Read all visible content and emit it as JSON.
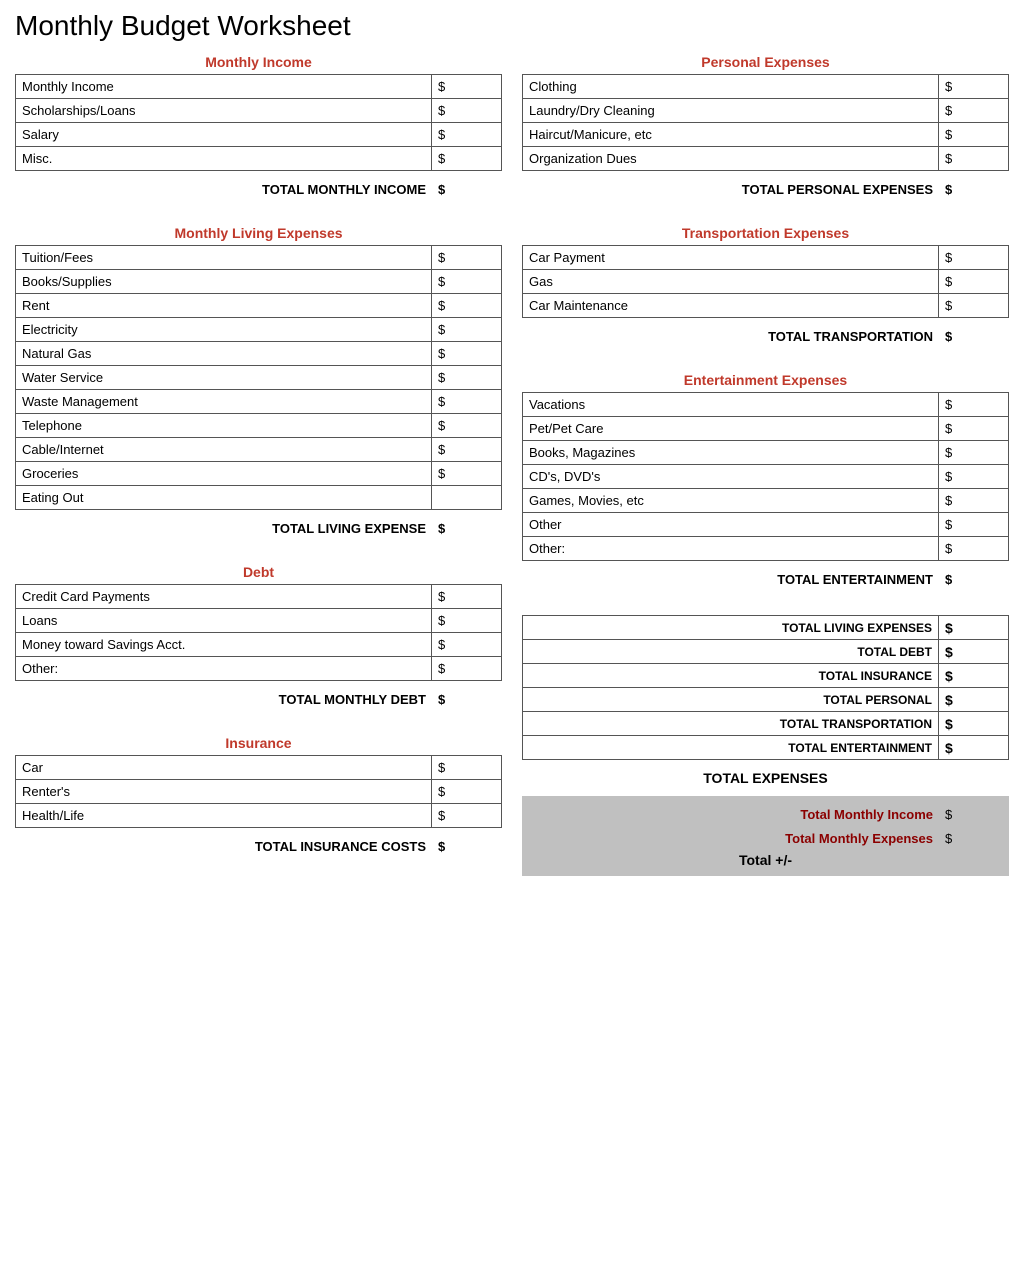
{
  "title": "Monthly Budget Worksheet",
  "left": {
    "income": {
      "heading": "Monthly Income",
      "rows": [
        {
          "label": "Monthly Income",
          "dollar": "$"
        },
        {
          "label": "Scholarships/Loans",
          "dollar": "$"
        },
        {
          "label": "Salary",
          "dollar": "$"
        },
        {
          "label": "Misc.",
          "dollar": "$"
        }
      ],
      "total_label": "TOTAL MONTHLY INCOME",
      "total_dollar": "$"
    },
    "living": {
      "heading": "Monthly Living Expenses",
      "rows": [
        {
          "label": "Tuition/Fees",
          "dollar": "$"
        },
        {
          "label": "Books/Supplies",
          "dollar": "$"
        },
        {
          "label": "Rent",
          "dollar": "$"
        },
        {
          "label": "Electricity",
          "dollar": "$"
        },
        {
          "label": "Natural Gas",
          "dollar": "$"
        },
        {
          "label": "Water Service",
          "dollar": "$"
        },
        {
          "label": "Waste Management",
          "dollar": "$"
        },
        {
          "label": "Telephone",
          "dollar": "$"
        },
        {
          "label": "Cable/Internet",
          "dollar": "$"
        },
        {
          "label": "Groceries",
          "dollar": "$"
        },
        {
          "label": "Eating Out",
          "dollar": ""
        }
      ],
      "total_label": "TOTAL LIVING EXPENSE",
      "total_dollar": "$"
    },
    "debt": {
      "heading": "Debt",
      "rows": [
        {
          "label": "Credit Card Payments",
          "dollar": "$"
        },
        {
          "label": "Loans",
          "dollar": "$"
        },
        {
          "label": "Money toward Savings Acct.",
          "dollar": "$"
        },
        {
          "label": "Other:",
          "dollar": "$"
        }
      ],
      "total_label": "TOTAL MONTHLY DEBT",
      "total_dollar": "$"
    },
    "insurance": {
      "heading": "Insurance",
      "rows": [
        {
          "label": "Car",
          "dollar": "$"
        },
        {
          "label": "Renter's",
          "dollar": "$"
        },
        {
          "label": "Health/Life",
          "dollar": "$"
        }
      ],
      "total_label": "TOTAL INSURANCE COSTS",
      "total_dollar": "$"
    }
  },
  "right": {
    "personal": {
      "heading": "Personal Expenses",
      "rows": [
        {
          "label": "Clothing",
          "dollar": "$"
        },
        {
          "label": "Laundry/Dry Cleaning",
          "dollar": "$"
        },
        {
          "label": "Haircut/Manicure, etc",
          "dollar": "$"
        },
        {
          "label": "Organization Dues",
          "dollar": "$"
        }
      ],
      "total_label": "TOTAL PERSONAL EXPENSES",
      "total_dollar": "$"
    },
    "transportation": {
      "heading": "Transportation Expenses",
      "rows": [
        {
          "label": "Car Payment",
          "dollar": "$"
        },
        {
          "label": "Gas",
          "dollar": "$"
        },
        {
          "label": "Car Maintenance",
          "dollar": "$"
        }
      ],
      "total_label": "TOTAL TRANSPORTATION",
      "total_dollar": "$"
    },
    "entertainment": {
      "heading": "Entertainment Expenses",
      "rows": [
        {
          "label": "Vacations",
          "dollar": "$"
        },
        {
          "label": "Pet/Pet Care",
          "dollar": "$"
        },
        {
          "label": "Books, Magazines",
          "dollar": "$"
        },
        {
          "label": "CD's, DVD's",
          "dollar": "$"
        },
        {
          "label": "Games, Movies, etc",
          "dollar": "$"
        },
        {
          "label": "Other",
          "dollar": "$"
        },
        {
          "label": "Other:",
          "dollar": "$"
        }
      ],
      "total_label": "TOTAL ENTERTAINMENT",
      "total_dollar": "$"
    },
    "summary": {
      "rows": [
        {
          "label": "TOTAL LIVING EXPENSES",
          "dollar": "$"
        },
        {
          "label": "TOTAL DEBT",
          "dollar": "$"
        },
        {
          "label": "TOTAL INSURANCE",
          "dollar": "$"
        },
        {
          "label": "TOTAL PERSONAL",
          "dollar": "$"
        },
        {
          "label": "TOTAL TRANSPORTATION",
          "dollar": "$"
        },
        {
          "label": "TOTAL ENTERTAINMENT",
          "dollar": "$"
        }
      ],
      "total_expenses": "TOTAL EXPENSES"
    },
    "bottom": {
      "monthly_income_label": "Total Monthly Income",
      "monthly_income_dollar": "$",
      "monthly_expenses_label": "Total Monthly Expenses",
      "monthly_expenses_dollar": "$",
      "total_plus_minus": "Total +/-"
    }
  }
}
